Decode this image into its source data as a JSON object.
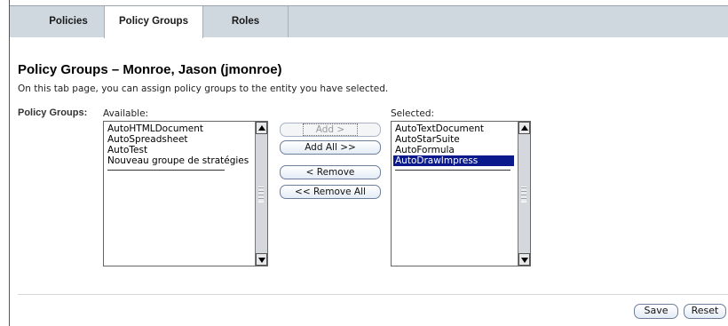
{
  "tabs": [
    {
      "label": "Policies"
    },
    {
      "label": "Policy Groups"
    },
    {
      "label": "Roles"
    }
  ],
  "page": {
    "title": "Policy Groups – Monroe, Jason (jmonroe)",
    "description": "On this tab page, you can assign policy groups to the entity you have selected.",
    "field_label": "Policy Groups:"
  },
  "available": {
    "label": "Available:",
    "items": [
      "AutoHTMLDocument",
      "AutoSpreadsheet",
      "AutoTest",
      "Nouveau groupe de stratégies"
    ]
  },
  "selected": {
    "label": "Selected:",
    "items": [
      "AutoTextDocument",
      "AutoStarSuite",
      "AutoFormula",
      "AutoDrawImpress"
    ],
    "highlighted": "AutoDrawImpress"
  },
  "transfer": {
    "add_label": "Add    >",
    "add_all_label": "Add All   >>",
    "remove_label": "<   Remove",
    "remove_all_label": "<< Remove All"
  },
  "footer": {
    "save_label": "Save",
    "reset_label": "Reset"
  },
  "colors": {
    "tabbar": "#cfd7df",
    "selection": "#0a1a8c"
  }
}
